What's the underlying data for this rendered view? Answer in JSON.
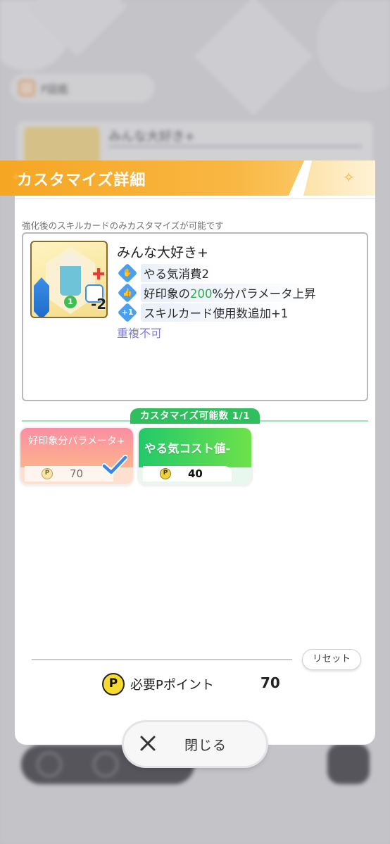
{
  "background": {
    "tab_label": "P図鑑",
    "card_title": "みんな大好き+"
  },
  "dialog": {
    "title": "カスタマイズ詳細",
    "note": "強化後のスキルカードのみカスタマイズが可能です",
    "card": {
      "name": "みんな大好き+",
      "art_cost": "-2",
      "art_badge": "1",
      "effects": [
        {
          "icon": "hand-icon",
          "text": "やる気消費2"
        },
        {
          "icon": "thumbs-up-icon",
          "text_before": "好印象の",
          "highlight": "200",
          "text_after": "%分パラメータ上昇"
        },
        {
          "icon": "card-plus-icon",
          "text": "スキルカード使用数追加+1"
        }
      ],
      "no_duplicate": "重複不可"
    },
    "customize_badge": "カスタマイズ可能数 1/1",
    "options": [
      {
        "label": "好印象分パラメータ+",
        "cost": "70",
        "selected": true,
        "color": "#fb8ea2"
      },
      {
        "label": "やる気コスト値-",
        "cost": "40",
        "selected": false,
        "color": "#22c96a"
      }
    ],
    "reset_label": "リセット",
    "required_label": "必要Pポイント",
    "required_value": "70",
    "coin_letter": "P"
  },
  "close_label": "閉じる",
  "colors": {
    "header": "#f5a623",
    "accent_green": "#2fbf5d",
    "highlight_green": "#2bb04a",
    "no_duplicate": "#7f7bd8"
  }
}
